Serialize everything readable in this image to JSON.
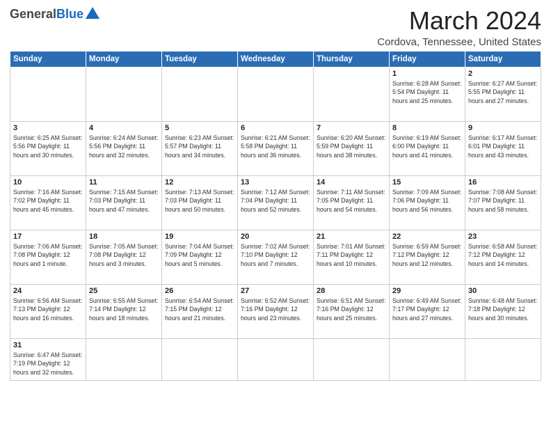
{
  "header": {
    "logo_general": "General",
    "logo_blue": "Blue",
    "month_title": "March 2024",
    "location": "Cordova, Tennessee, United States"
  },
  "weekdays": [
    "Sunday",
    "Monday",
    "Tuesday",
    "Wednesday",
    "Thursday",
    "Friday",
    "Saturday"
  ],
  "weeks": [
    [
      {
        "day": "",
        "info": ""
      },
      {
        "day": "",
        "info": ""
      },
      {
        "day": "",
        "info": ""
      },
      {
        "day": "",
        "info": ""
      },
      {
        "day": "",
        "info": ""
      },
      {
        "day": "1",
        "info": "Sunrise: 6:28 AM\nSunset: 5:54 PM\nDaylight: 11 hours\nand 25 minutes."
      },
      {
        "day": "2",
        "info": "Sunrise: 6:27 AM\nSunset: 5:55 PM\nDaylight: 11 hours\nand 27 minutes."
      }
    ],
    [
      {
        "day": "3",
        "info": "Sunrise: 6:25 AM\nSunset: 5:56 PM\nDaylight: 11 hours\nand 30 minutes."
      },
      {
        "day": "4",
        "info": "Sunrise: 6:24 AM\nSunset: 5:56 PM\nDaylight: 11 hours\nand 32 minutes."
      },
      {
        "day": "5",
        "info": "Sunrise: 6:23 AM\nSunset: 5:57 PM\nDaylight: 11 hours\nand 34 minutes."
      },
      {
        "day": "6",
        "info": "Sunrise: 6:21 AM\nSunset: 5:58 PM\nDaylight: 11 hours\nand 36 minutes."
      },
      {
        "day": "7",
        "info": "Sunrise: 6:20 AM\nSunset: 5:59 PM\nDaylight: 11 hours\nand 38 minutes."
      },
      {
        "day": "8",
        "info": "Sunrise: 6:19 AM\nSunset: 6:00 PM\nDaylight: 11 hours\nand 41 minutes."
      },
      {
        "day": "9",
        "info": "Sunrise: 6:17 AM\nSunset: 6:01 PM\nDaylight: 11 hours\nand 43 minutes."
      }
    ],
    [
      {
        "day": "10",
        "info": "Sunrise: 7:16 AM\nSunset: 7:02 PM\nDaylight: 11 hours\nand 45 minutes."
      },
      {
        "day": "11",
        "info": "Sunrise: 7:15 AM\nSunset: 7:03 PM\nDaylight: 11 hours\nand 47 minutes."
      },
      {
        "day": "12",
        "info": "Sunrise: 7:13 AM\nSunset: 7:03 PM\nDaylight: 11 hours\nand 50 minutes."
      },
      {
        "day": "13",
        "info": "Sunrise: 7:12 AM\nSunset: 7:04 PM\nDaylight: 11 hours\nand 52 minutes."
      },
      {
        "day": "14",
        "info": "Sunrise: 7:11 AM\nSunset: 7:05 PM\nDaylight: 11 hours\nand 54 minutes."
      },
      {
        "day": "15",
        "info": "Sunrise: 7:09 AM\nSunset: 7:06 PM\nDaylight: 11 hours\nand 56 minutes."
      },
      {
        "day": "16",
        "info": "Sunrise: 7:08 AM\nSunset: 7:07 PM\nDaylight: 11 hours\nand 58 minutes."
      }
    ],
    [
      {
        "day": "17",
        "info": "Sunrise: 7:06 AM\nSunset: 7:08 PM\nDaylight: 12 hours\nand 1 minute."
      },
      {
        "day": "18",
        "info": "Sunrise: 7:05 AM\nSunset: 7:08 PM\nDaylight: 12 hours\nand 3 minutes."
      },
      {
        "day": "19",
        "info": "Sunrise: 7:04 AM\nSunset: 7:09 PM\nDaylight: 12 hours\nand 5 minutes."
      },
      {
        "day": "20",
        "info": "Sunrise: 7:02 AM\nSunset: 7:10 PM\nDaylight: 12 hours\nand 7 minutes."
      },
      {
        "day": "21",
        "info": "Sunrise: 7:01 AM\nSunset: 7:11 PM\nDaylight: 12 hours\nand 10 minutes."
      },
      {
        "day": "22",
        "info": "Sunrise: 6:59 AM\nSunset: 7:12 PM\nDaylight: 12 hours\nand 12 minutes."
      },
      {
        "day": "23",
        "info": "Sunrise: 6:58 AM\nSunset: 7:12 PM\nDaylight: 12 hours\nand 14 minutes."
      }
    ],
    [
      {
        "day": "24",
        "info": "Sunrise: 6:56 AM\nSunset: 7:13 PM\nDaylight: 12 hours\nand 16 minutes."
      },
      {
        "day": "25",
        "info": "Sunrise: 6:55 AM\nSunset: 7:14 PM\nDaylight: 12 hours\nand 18 minutes."
      },
      {
        "day": "26",
        "info": "Sunrise: 6:54 AM\nSunset: 7:15 PM\nDaylight: 12 hours\nand 21 minutes."
      },
      {
        "day": "27",
        "info": "Sunrise: 6:52 AM\nSunset: 7:16 PM\nDaylight: 12 hours\nand 23 minutes."
      },
      {
        "day": "28",
        "info": "Sunrise: 6:51 AM\nSunset: 7:16 PM\nDaylight: 12 hours\nand 25 minutes."
      },
      {
        "day": "29",
        "info": "Sunrise: 6:49 AM\nSunset: 7:17 PM\nDaylight: 12 hours\nand 27 minutes."
      },
      {
        "day": "30",
        "info": "Sunrise: 6:48 AM\nSunset: 7:18 PM\nDaylight: 12 hours\nand 30 minutes."
      }
    ],
    [
      {
        "day": "31",
        "info": "Sunrise: 6:47 AM\nSunset: 7:19 PM\nDaylight: 12 hours\nand 32 minutes."
      },
      {
        "day": "",
        "info": ""
      },
      {
        "day": "",
        "info": ""
      },
      {
        "day": "",
        "info": ""
      },
      {
        "day": "",
        "info": ""
      },
      {
        "day": "",
        "info": ""
      },
      {
        "day": "",
        "info": ""
      }
    ]
  ]
}
